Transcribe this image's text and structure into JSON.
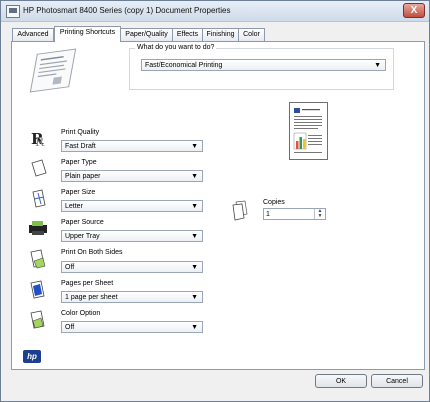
{
  "window": {
    "title": "HP Photosmart 8400 Series (copy 1) Document Properties",
    "close": "X"
  },
  "tabs": [
    {
      "label": "Advanced"
    },
    {
      "label": "Printing Shortcuts"
    },
    {
      "label": "Paper/Quality"
    },
    {
      "label": "Effects"
    },
    {
      "label": "Finishing"
    },
    {
      "label": "Color"
    }
  ],
  "shortcut": {
    "label": "What do you want to do?",
    "value": "Fast/Economical Printing"
  },
  "settings": [
    {
      "label": "Print Quality",
      "value": "Fast Draft",
      "icon": "print-quality-icon"
    },
    {
      "label": "Paper Type",
      "value": "Plain paper",
      "icon": "paper-type-icon"
    },
    {
      "label": "Paper Size",
      "value": "Letter",
      "icon": "paper-size-icon"
    },
    {
      "label": "Paper Source",
      "value": "Upper Tray",
      "icon": "printer-tray-icon"
    },
    {
      "label": "Print On Both Sides",
      "value": "Off",
      "icon": "duplex-icon"
    },
    {
      "label": "Pages per Sheet",
      "value": "1 page per sheet",
      "icon": "pages-per-sheet-icon"
    },
    {
      "label": "Color Option",
      "value": "Off",
      "icon": "color-option-icon"
    }
  ],
  "copies": {
    "label": "Copies",
    "value": "1"
  },
  "buttons": {
    "ok": "OK",
    "cancel": "Cancel"
  },
  "logo": {
    "text": "hp"
  },
  "colors": {
    "accent": "#1d3f8f"
  }
}
